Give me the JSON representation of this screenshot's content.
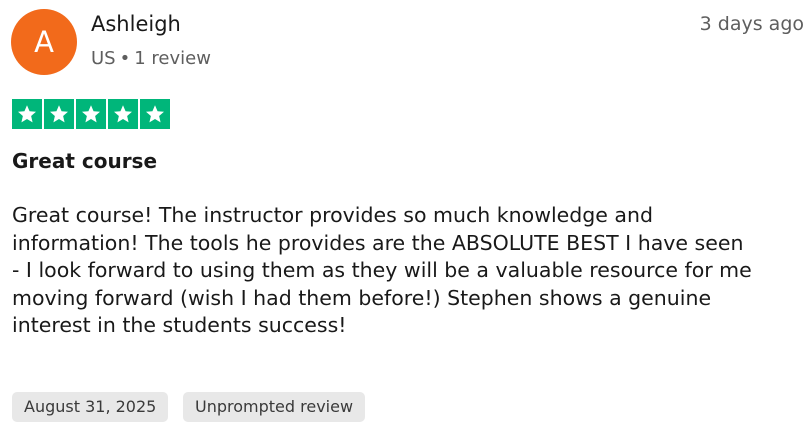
{
  "reviewer": {
    "initial": "A",
    "name": "Ashleigh",
    "country": "US",
    "review_count": "1 review",
    "avatar_color": "#f26a1b"
  },
  "time_ago": "3 days ago",
  "rating": {
    "value": 5,
    "max": 5,
    "color": "#00b67a",
    "icon": "star-icon"
  },
  "review": {
    "title": "Great course",
    "body_lines": [
      "Great course! The instructor provides so much knowledge and",
      "information! The tools he provides are the ABSOLUTE BEST I have seen",
      "- I look forward to using them as they will be a valuable resource for me",
      "moving forward (wish I had them before!) Stephen shows a genuine",
      "interest in the students success!"
    ]
  },
  "tags": {
    "date": "August 31, 2025",
    "source": "Unprompted review"
  }
}
